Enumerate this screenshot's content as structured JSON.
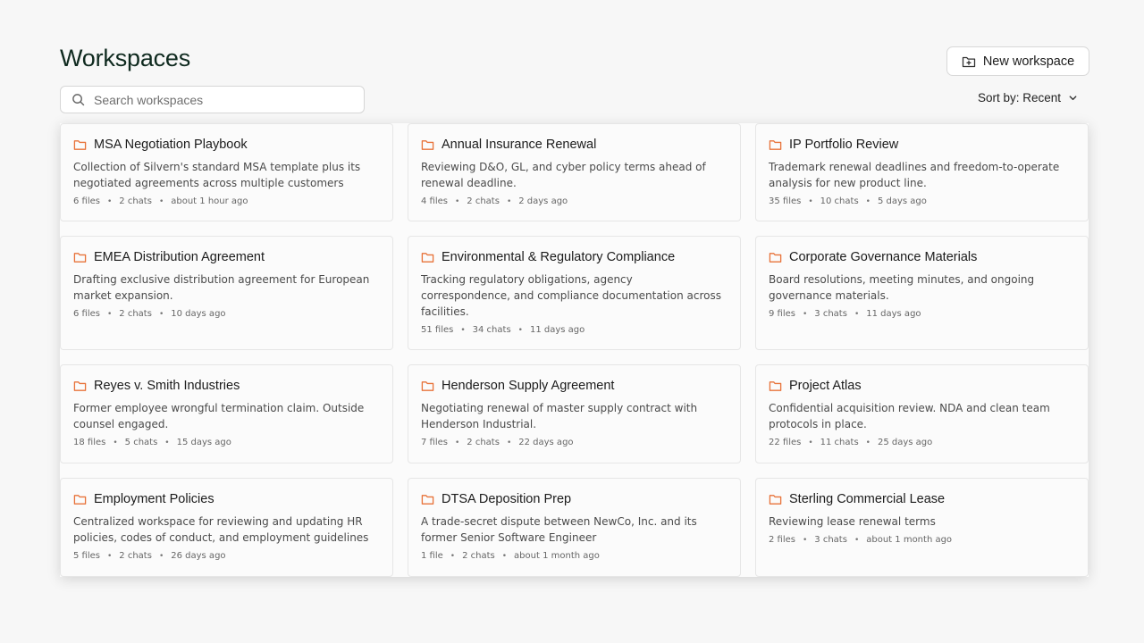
{
  "header": {
    "title": "Workspaces",
    "new_button_label": "New workspace"
  },
  "search": {
    "placeholder": "Search workspaces",
    "value": ""
  },
  "sort": {
    "label": "Sort by: Recent"
  },
  "colors": {
    "folder_icon": "#e8733a",
    "title": "#0f2a1f"
  },
  "workspaces": [
    {
      "title": "MSA Negotiation Playbook",
      "desc": "Collection of Silvern's standard MSA template plus its negotiated agreements across multiple customers",
      "files": "6 files",
      "chats": "2 chats",
      "updated": "about 1 hour ago"
    },
    {
      "title": "Annual Insurance Renewal",
      "desc": "Reviewing D&O, GL, and cyber policy terms ahead of renewal deadline.",
      "files": "4 files",
      "chats": "2 chats",
      "updated": "2 days ago"
    },
    {
      "title": "IP Portfolio Review",
      "desc": "Trademark renewal deadlines and freedom-to-operate analysis for new product line.",
      "files": "35 files",
      "chats": "10 chats",
      "updated": "5 days ago"
    },
    {
      "title": "EMEA Distribution Agreement",
      "desc": "Drafting exclusive distribution agreement for European market expansion.",
      "files": "6 files",
      "chats": "2 chats",
      "updated": "10 days ago"
    },
    {
      "title": "Environmental & Regulatory Compliance",
      "desc": "Tracking regulatory obligations, agency correspondence, and compliance documentation across facilities.",
      "files": "51 files",
      "chats": "34 chats",
      "updated": "11 days ago"
    },
    {
      "title": "Corporate Governance Materials",
      "desc": "Board resolutions, meeting minutes, and ongoing governance materials.",
      "files": "9 files",
      "chats": "3 chats",
      "updated": "11 days ago"
    },
    {
      "title": "Reyes v. Smith Industries",
      "desc": "Former employee wrongful termination claim. Outside counsel engaged.",
      "files": "18 files",
      "chats": "5 chats",
      "updated": "15 days ago"
    },
    {
      "title": "Henderson Supply Agreement",
      "desc": "Negotiating renewal of master supply contract with Henderson Industrial.",
      "files": "7 files",
      "chats": "2 chats",
      "updated": "22 days ago"
    },
    {
      "title": "Project Atlas",
      "desc": "Confidential acquisition review. NDA and clean team protocols in place.",
      "files": "22 files",
      "chats": "11 chats",
      "updated": "25 days ago"
    },
    {
      "title": "Employment Policies",
      "desc": "Centralized workspace for reviewing and updating HR policies, codes of conduct, and employment guidelines",
      "files": "5 files",
      "chats": "2 chats",
      "updated": "26 days ago"
    },
    {
      "title": "DTSA Deposition Prep",
      "desc": "A trade-secret dispute between NewCo, Inc. and its former Senior Software Engineer",
      "files": "1 file",
      "chats": "2 chats",
      "updated": "about 1 month ago"
    },
    {
      "title": "Sterling Commercial Lease",
      "desc": "Reviewing lease renewal terms",
      "files": "2 files",
      "chats": "3 chats",
      "updated": "about 1 month ago"
    }
  ]
}
